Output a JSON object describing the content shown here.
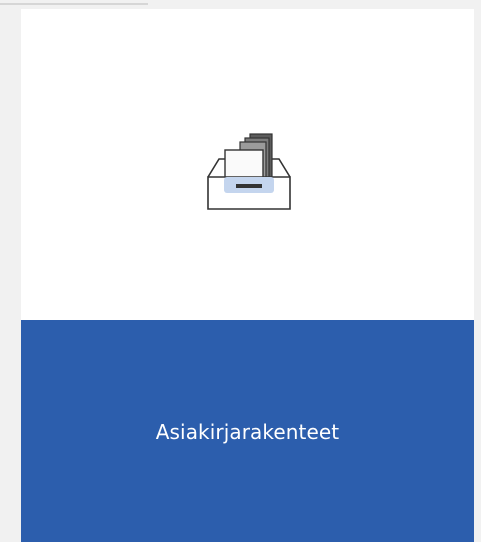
{
  "tile": {
    "label": "Asiakirjarakenteet",
    "icon": "document-tray-icon",
    "colors": {
      "band": "#2c5ead",
      "label_text": "#ffffff",
      "tile_background": "#ffffff",
      "page_background": "#f1f1f1"
    }
  }
}
